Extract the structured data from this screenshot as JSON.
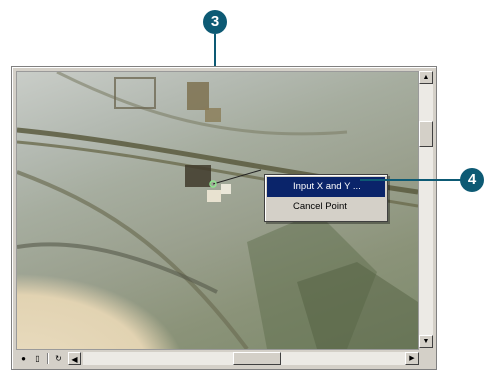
{
  "callouts": {
    "step_3": "3",
    "step_4": "4"
  },
  "context_menu": {
    "items": [
      {
        "label": "Input X and Y ...",
        "selected": true
      },
      {
        "label": "Cancel Point",
        "selected": false
      }
    ]
  },
  "colors": {
    "callout": "#0d5a74",
    "menu_highlight": "#0a246a",
    "window_face": "#d4d0c8"
  },
  "icons": {
    "view_toolbar": [
      "globe-icon",
      "page-layout-icon",
      "refresh-icon",
      "scroll-left-icon"
    ],
    "scrollbar": [
      "scroll-up-icon",
      "scroll-down-icon",
      "scroll-right-icon"
    ]
  }
}
